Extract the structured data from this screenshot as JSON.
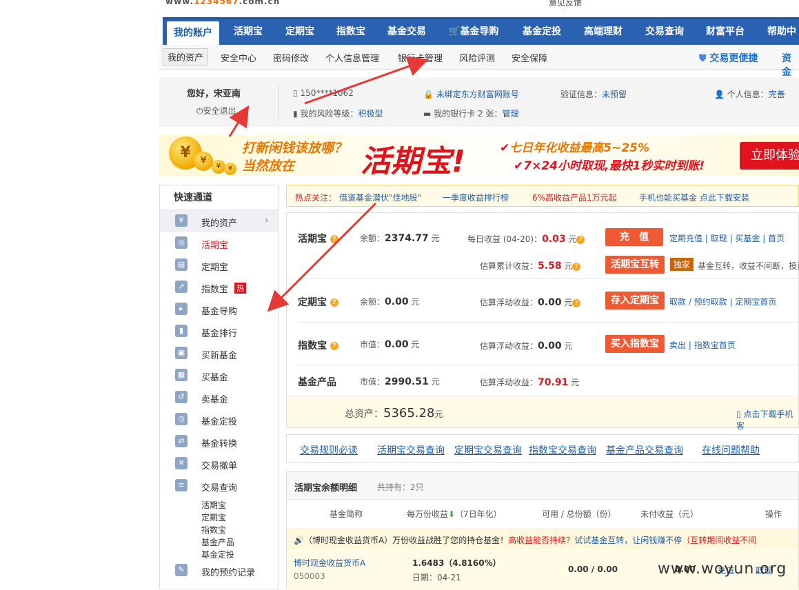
{
  "top": {
    "url_prefix": "www.",
    "url_num": "1234567",
    "url_suffix": ".com.cn",
    "misc": "意见反馈"
  },
  "nav": {
    "items": [
      "我的账户",
      "活期宝",
      "定期宝",
      "指数宝",
      "基金交易",
      "基金导购",
      "基金定投",
      "高端理财",
      "交易查询",
      "财富平台",
      "帮助中"
    ]
  },
  "subnav": {
    "items": [
      "我的资产",
      "安全中心",
      "密码修改",
      "个人信息管理",
      "银行卡管理",
      "风险评测",
      "安全保障"
    ],
    "right1": "交易更便捷",
    "right2": "资金"
  },
  "user": {
    "greeting": "您好，宋亚南",
    "logout": "安全退出",
    "phone": "150****1062",
    "bind": "未绑定东方财富网账号",
    "verify_label": "验证信息：",
    "verify_value": "未预留",
    "info_label": "个人信息：",
    "info_value": "完善",
    "risk_label": "我的风险等级：",
    "risk_value": "积极型",
    "cards_label": "我的银行卡 2 张：",
    "cards_value": "管理"
  },
  "banner": {
    "line1": "打新闲钱该放哪？",
    "line2": "当然放在",
    "big": "活期宝!",
    "r1": "七日年化收益最高5~25%",
    "r2": "7×24小时取现,最快1秒实时到账!",
    "btn": "立即体验",
    "coin": "¥"
  },
  "side": {
    "title": "快速通道",
    "items": [
      {
        "label": "我的资产",
        "icon": "¥"
      },
      {
        "label": "活期宝",
        "icon": "◎"
      },
      {
        "label": "定期宝",
        "icon": "▤"
      },
      {
        "label": "指数宝",
        "icon": "↗"
      },
      {
        "label": "基金导购",
        "icon": "▸"
      },
      {
        "label": "基金排行",
        "icon": "▮"
      },
      {
        "label": "买新基金",
        "icon": "▣"
      },
      {
        "label": "买基金",
        "icon": "▦"
      },
      {
        "label": "卖基金",
        "icon": "↺"
      },
      {
        "label": "基金定投",
        "icon": "◷"
      },
      {
        "label": "基金转换",
        "icon": "⇄"
      },
      {
        "label": "交易撤单",
        "icon": "✕"
      },
      {
        "label": "交易查询",
        "icon": "≡"
      }
    ],
    "hot": "热",
    "subs": [
      "活期宝",
      "定期宝",
      "指数宝",
      "基金产品",
      "基金定投"
    ],
    "last": "我的预约记录"
  },
  "notice": {
    "label": "热点关注：",
    "items": [
      "借道基金潜伏\"佳地股\"",
      "一季度收益排行榜",
      "6%高收益产品1万元起",
      "手机也能买基金 点此下载安装"
    ]
  },
  "assets": {
    "hqb": {
      "name": "活期宝",
      "bal_label": "余额：",
      "bal": "2374.77",
      "unit": "元",
      "day_label": "每日收益",
      "day_date": "(04-20)：",
      "day": "0.03",
      "acc_label": "估算累计收益：",
      "acc": "5.58",
      "btn1": "充　值",
      "btn2": "活期宝互转",
      "links1": [
        "定期充值",
        "取现",
        "买基金",
        "首页"
      ],
      "tag": "独家",
      "desc": "基金互转，收益不间断，投资"
    },
    "dqb": {
      "name": "定期宝",
      "bal_label": "余额：",
      "bal": "0.00",
      "float_label": "估算浮动收益：",
      "float": "0.00",
      "btn": "存入定期宝",
      "links": [
        "取款 / 预约取款",
        "定期宝首页"
      ]
    },
    "zsb": {
      "name": "指数宝",
      "bal_label": "市值：",
      "bal": "0.00",
      "float_label": "估算浮动收益：",
      "float": "0.00",
      "btn": "买入指数宝",
      "links": [
        "卖出",
        "指数宝首页"
      ]
    },
    "jj": {
      "name": "基金产品",
      "bal_label": "市值：",
      "bal": "2990.51",
      "float_label": "估算浮动收益：",
      "float": "70.91"
    },
    "total_label": "总资产：",
    "total": "5365.28",
    "total_unit": "元",
    "download": "点击下载手机客"
  },
  "qlinks": [
    "交易规则必读",
    "活期宝交易查询",
    "定期宝交易查询",
    "指数宝交易查询",
    "基金产品交易查询",
    "在线问题帮助"
  ],
  "detail": {
    "title": "活期宝余额明细",
    "hold": "共持有：2只",
    "cols": [
      "基金简称",
      "每万份收益",
      "（7日年化）",
      "可用 / 总份额（份）",
      "未付收益（元）",
      "操作"
    ],
    "tip1": "（博时现金收益货币A）万份收益战胜了您的持仓基金！",
    "tip2": "高收益能否持续？",
    "tip3": "试试基金互转，让闲钱赚不停",
    "tip4": "（互转期间收益不间",
    "fund": "博时现金收益货币A",
    "code": "050003",
    "wan": "1.6483（4.8160%）",
    "date": "日期：04-21",
    "share": "0.00 / 0.00",
    "unpaid": "0.00",
    "ops": [
      "充值",
      "取现"
    ]
  },
  "watermark": "www.woyun.org"
}
